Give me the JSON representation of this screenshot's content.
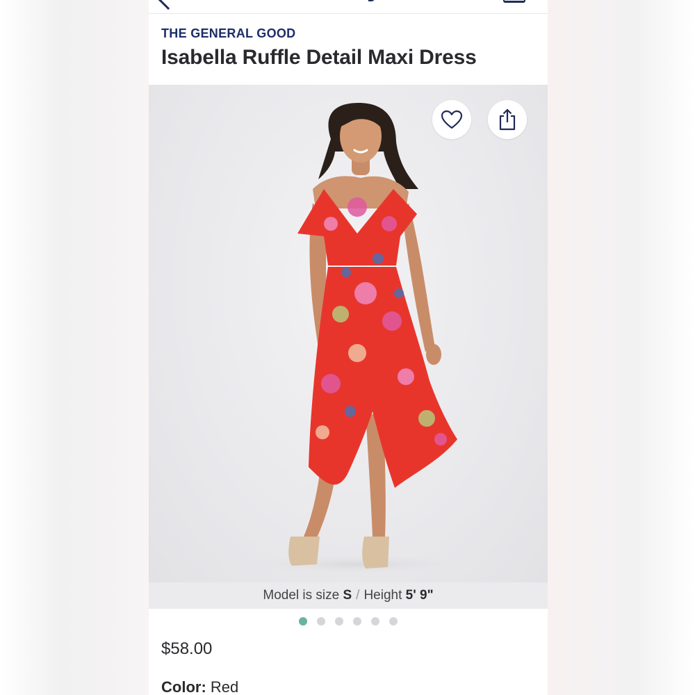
{
  "product": {
    "brand": "THE GENERAL GOOD",
    "title": "Isabella Ruffle Detail Maxi Dress",
    "price": "$58.00",
    "color_label": "Color:",
    "color_value": "Red"
  },
  "image": {
    "caption_prefix": "Model is size",
    "model_size": "S",
    "separator": "/",
    "height_label": "Height",
    "model_height": "5' 9\""
  },
  "carousel": {
    "count": 6,
    "active_index": 0
  },
  "icons": {
    "favorite": "heart-icon",
    "share": "share-icon",
    "back": "chevron-left-icon",
    "menu": "menu-icon"
  },
  "colors": {
    "brand_text": "#1c2d6b",
    "active_dot": "#6ab3a1",
    "dress_red": "#e8352c"
  }
}
